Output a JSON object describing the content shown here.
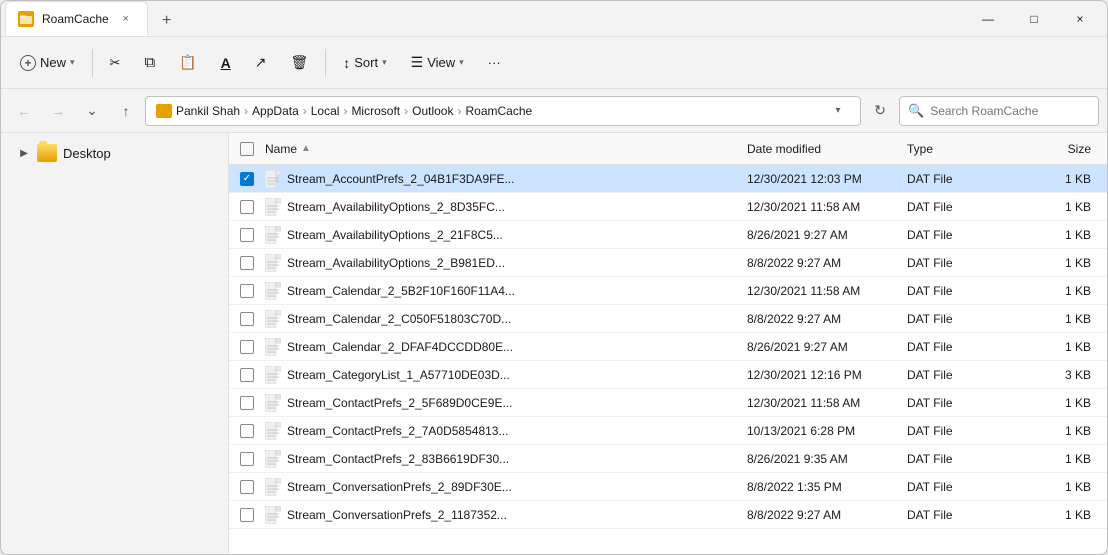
{
  "window": {
    "title": "RoamCache",
    "tab_close": "×",
    "new_tab": "+",
    "min": "—",
    "max": "□",
    "close": "×"
  },
  "toolbar": {
    "new_label": "New",
    "cut_icon": "✂",
    "copy_icon": "⧉",
    "paste_icon": "📋",
    "rename_icon": "Ａ",
    "share_icon": "↗",
    "delete_icon": "🗑",
    "sort_label": "Sort",
    "view_label": "View",
    "more_label": "···"
  },
  "addressbar": {
    "breadcrumb": "Pankil Shah  >  AppData  >  Local  >  Microsoft  >  Outlook  >  RoamCache",
    "search_placeholder": "Search RoamCache"
  },
  "sidebar": {
    "items": [
      {
        "label": "Desktop",
        "icon": "folder",
        "expanded": false
      }
    ]
  },
  "filelist": {
    "columns": {
      "name": "Name",
      "date_modified": "Date modified",
      "type": "Type",
      "size": "Size"
    },
    "files": [
      {
        "name": "Stream_AccountPrefs_2_04B1F3DA9FE...",
        "date": "12/30/2021 12:03 PM",
        "type": "DAT File",
        "size": "1 KB",
        "selected": true
      },
      {
        "name": "Stream_AvailabilityOptions_2_8D35FC...",
        "date": "12/30/2021 11:58 AM",
        "type": "DAT File",
        "size": "1 KB",
        "selected": false
      },
      {
        "name": "Stream_AvailabilityOptions_2_21F8C5...",
        "date": "8/26/2021 9:27 AM",
        "type": "DAT File",
        "size": "1 KB",
        "selected": false
      },
      {
        "name": "Stream_AvailabilityOptions_2_B981ED...",
        "date": "8/8/2022 9:27 AM",
        "type": "DAT File",
        "size": "1 KB",
        "selected": false
      },
      {
        "name": "Stream_Calendar_2_5B2F10F160F11A4...",
        "date": "12/30/2021 11:58 AM",
        "type": "DAT File",
        "size": "1 KB",
        "selected": false
      },
      {
        "name": "Stream_Calendar_2_C050F51803C70D...",
        "date": "8/8/2022 9:27 AM",
        "type": "DAT File",
        "size": "1 KB",
        "selected": false
      },
      {
        "name": "Stream_Calendar_2_DFAF4DCCDD80E...",
        "date": "8/26/2021 9:27 AM",
        "type": "DAT File",
        "size": "1 KB",
        "selected": false
      },
      {
        "name": "Stream_CategoryList_1_A57710DE03D...",
        "date": "12/30/2021 12:16 PM",
        "type": "DAT File",
        "size": "3 KB",
        "selected": false
      },
      {
        "name": "Stream_ContactPrefs_2_5F689D0CE9E...",
        "date": "12/30/2021 11:58 AM",
        "type": "DAT File",
        "size": "1 KB",
        "selected": false
      },
      {
        "name": "Stream_ContactPrefs_2_7A0D5854813...",
        "date": "10/13/2021 6:28 PM",
        "type": "DAT File",
        "size": "1 KB",
        "selected": false
      },
      {
        "name": "Stream_ContactPrefs_2_83B6619DF30...",
        "date": "8/26/2021 9:35 AM",
        "type": "DAT File",
        "size": "1 KB",
        "selected": false
      },
      {
        "name": "Stream_ConversationPrefs_2_89DF30E...",
        "date": "8/8/2022 1:35 PM",
        "type": "DAT File",
        "size": "1 KB",
        "selected": false
      },
      {
        "name": "Stream_ConversationPrefs_2_1187352...",
        "date": "8/8/2022 9:27 AM",
        "type": "DAT File",
        "size": "1 KB",
        "selected": false
      }
    ]
  }
}
